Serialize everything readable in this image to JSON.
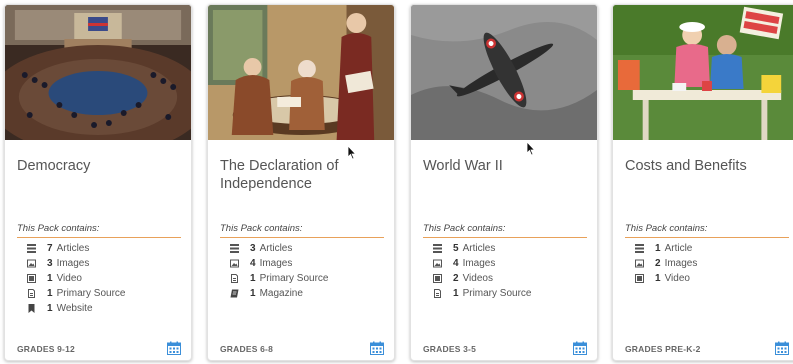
{
  "accent_color": "#e8a15a",
  "calendar_color": "#3b8fd9",
  "cards": [
    {
      "title": "Democracy",
      "contains_label": "This Pack contains:",
      "image_subject": "legislative chamber",
      "items": [
        {
          "icon": "article-icon",
          "count": "7",
          "label": "Articles"
        },
        {
          "icon": "image-icon",
          "count": "3",
          "label": "Images"
        },
        {
          "icon": "video-icon",
          "count": "1",
          "label": "Video"
        },
        {
          "icon": "document-icon",
          "count": "1",
          "label": "Primary Source"
        },
        {
          "icon": "bookmark-icon",
          "count": "1",
          "label": "Website"
        }
      ],
      "grades": "GRADES 9-12"
    },
    {
      "title": "The Declaration of Independence",
      "contains_label": "This Pack contains:",
      "image_subject": "founding fathers painting",
      "items": [
        {
          "icon": "article-icon",
          "count": "3",
          "label": "Articles"
        },
        {
          "icon": "image-icon",
          "count": "4",
          "label": "Images"
        },
        {
          "icon": "document-icon",
          "count": "1",
          "label": "Primary Source"
        },
        {
          "icon": "magazine-icon",
          "count": "1",
          "label": "Magazine"
        }
      ],
      "grades": "GRADES 6-8"
    },
    {
      "title": "World War II",
      "contains_label": "This Pack contains:",
      "image_subject": "fighter plane",
      "items": [
        {
          "icon": "article-icon",
          "count": "5",
          "label": "Articles"
        },
        {
          "icon": "image-icon",
          "count": "4",
          "label": "Images"
        },
        {
          "icon": "video-icon",
          "count": "2",
          "label": "Videos"
        },
        {
          "icon": "document-icon",
          "count": "1",
          "label": "Primary Source"
        }
      ],
      "grades": "GRADES 3-5"
    },
    {
      "title": "Costs and Benefits",
      "contains_label": "This Pack contains:",
      "image_subject": "children garage sale",
      "items": [
        {
          "icon": "article-icon",
          "count": "1",
          "label": "Article"
        },
        {
          "icon": "image-icon",
          "count": "2",
          "label": "Images"
        },
        {
          "icon": "video-icon",
          "count": "1",
          "label": "Video"
        }
      ],
      "grades": "GRADES PRE-K-2"
    }
  ]
}
